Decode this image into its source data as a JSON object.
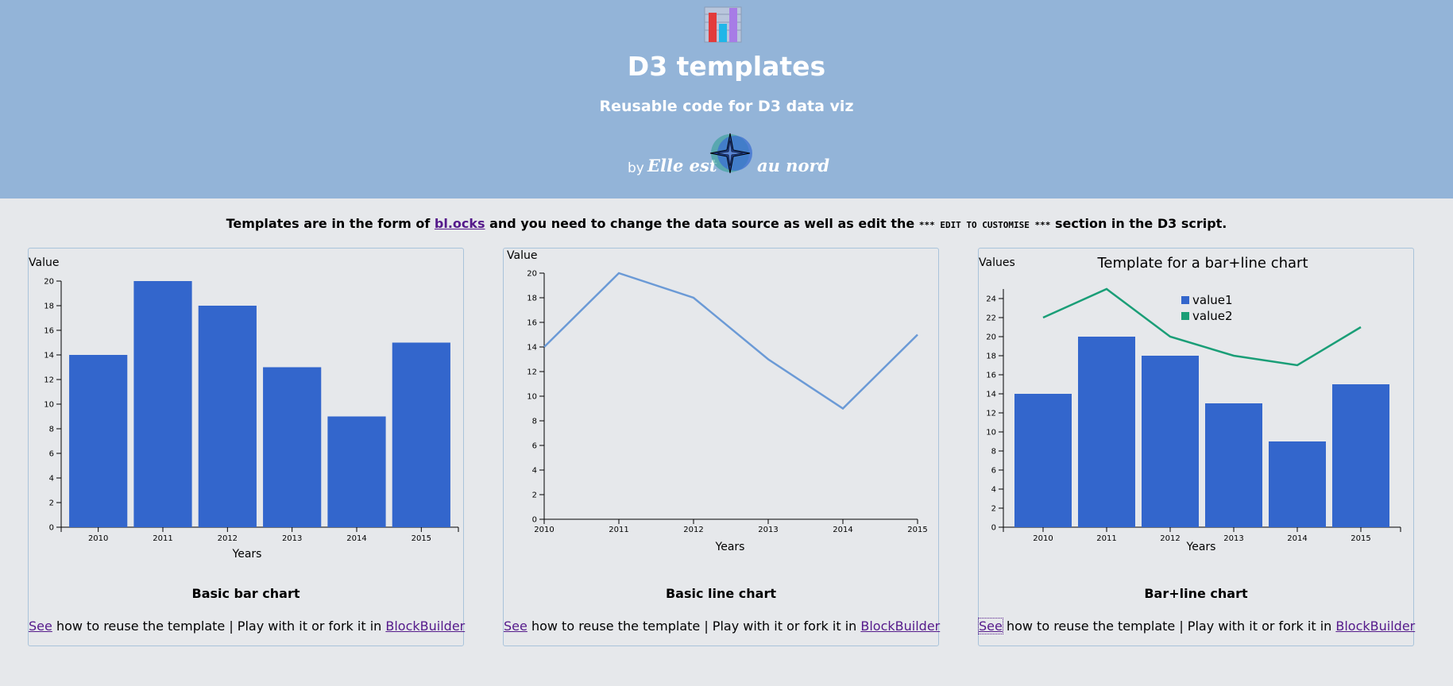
{
  "header": {
    "logo_icon": "bar-chart-icon",
    "title": "D3 templates",
    "subtitle": "Reusable code for D3 data viz",
    "by": "by",
    "brand_left": "Elle est",
    "brand_right": "au nord",
    "brand_icon": "compass-rose-icon"
  },
  "intro": {
    "prefix": "Templates are in the form of",
    "link": "bl.ocks",
    "middle": "and you need to change the data source as well as edit the",
    "code": "*** EDIT TO CUSTOMISE ***",
    "suffix": "section in the D3 script."
  },
  "cards": [
    {
      "title": "Basic bar chart",
      "see": "See",
      "text": "how to reuse the template | Play with it or fork it in",
      "link": "BlockBuilder"
    },
    {
      "title": "Basic line chart",
      "see": "See",
      "text": "how to reuse the template | Play with it or fork it in",
      "link": "BlockBuilder"
    },
    {
      "title": "Bar+line chart",
      "see": "See",
      "text": "how to reuse the template | Play with it or fork it in",
      "link": "BlockBuilder"
    }
  ],
  "colors": {
    "header_bg": "#93b4d8",
    "page_bg": "#e6e8eb",
    "bar": "#3366cc",
    "line": "#6b9ad6",
    "line2": "#1a9e77",
    "link": "#551a8b"
  },
  "chart_data": [
    {
      "type": "bar",
      "title": "",
      "categories": [
        "2010",
        "2011",
        "2012",
        "2013",
        "2014",
        "2015"
      ],
      "values": [
        14,
        20,
        18,
        13,
        9,
        15
      ],
      "xlabel": "Years",
      "ylabel": "Value",
      "ylim": [
        0,
        20
      ],
      "yticks": [
        0,
        2,
        4,
        6,
        8,
        10,
        12,
        14,
        16,
        18,
        20
      ]
    },
    {
      "type": "line",
      "title": "",
      "x": [
        "2010",
        "2011",
        "2012",
        "2013",
        "2014",
        "2015"
      ],
      "values": [
        14,
        20,
        18,
        13,
        9,
        15
      ],
      "xlabel": "Years",
      "ylabel": "Value",
      "ylim": [
        0,
        20
      ],
      "yticks": [
        0,
        2,
        4,
        6,
        8,
        10,
        12,
        14,
        16,
        18,
        20
      ]
    },
    {
      "type": "bar",
      "title": "Template for a bar+line chart",
      "categories": [
        "2010",
        "2011",
        "2012",
        "2013",
        "2014",
        "2015"
      ],
      "series": [
        {
          "name": "value1",
          "kind": "bar",
          "values": [
            14,
            20,
            18,
            13,
            9,
            15
          ]
        },
        {
          "name": "value2",
          "kind": "line",
          "values": [
            22,
            25,
            20,
            18,
            17,
            21
          ]
        }
      ],
      "xlabel": "Years",
      "ylabel": "Values",
      "ylim": [
        0,
        25
      ],
      "yticks": [
        0,
        2,
        4,
        6,
        8,
        10,
        12,
        14,
        16,
        18,
        20,
        22,
        24
      ],
      "legend": "top-center"
    }
  ]
}
